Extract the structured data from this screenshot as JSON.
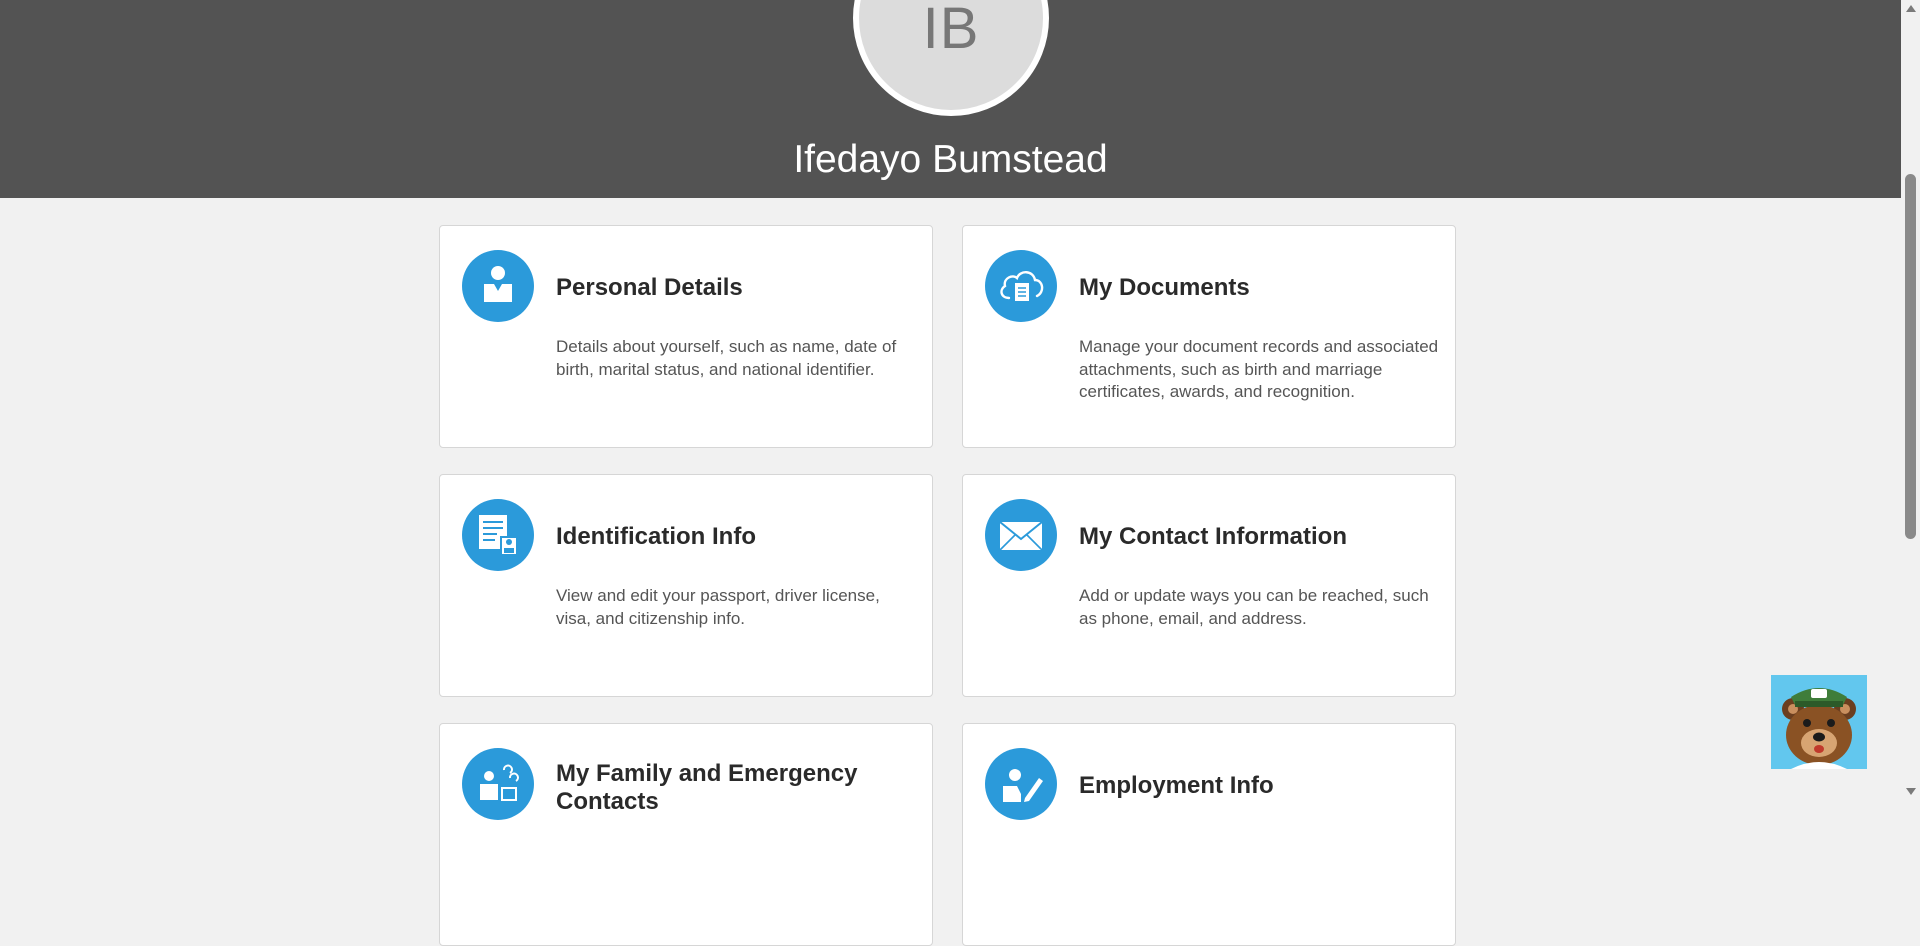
{
  "profile": {
    "initials": "IB",
    "name": "Ifedayo Bumstead"
  },
  "cards": [
    {
      "title": "Personal Details",
      "description": "Details about yourself, such as name, date of birth, marital status, and national identifier.",
      "icon": "person-icon"
    },
    {
      "title": "My Documents",
      "description": "Manage your document records and associated attachments, such as birth and marriage certificates, awards, and recognition.",
      "icon": "cloud-document-icon"
    },
    {
      "title": "Identification Info",
      "description": "View and edit your passport, driver license, visa, and citizenship info.",
      "icon": "id-document-icon"
    },
    {
      "title": "My Contact Information",
      "description": "Add or update ways you can be reached, such as phone, email, and address.",
      "icon": "envelope-icon"
    },
    {
      "title": "My Family and Emergency Contacts",
      "description": "",
      "icon": "family-icon"
    },
    {
      "title": "Employment Info",
      "description": "",
      "icon": "employee-edit-icon"
    }
  ],
  "colors": {
    "header": "#535353",
    "accent": "#2b9ada",
    "background": "#f1f1f1",
    "card": "#ffffff"
  },
  "assistant": {
    "icon": "bear-mascot-icon"
  }
}
